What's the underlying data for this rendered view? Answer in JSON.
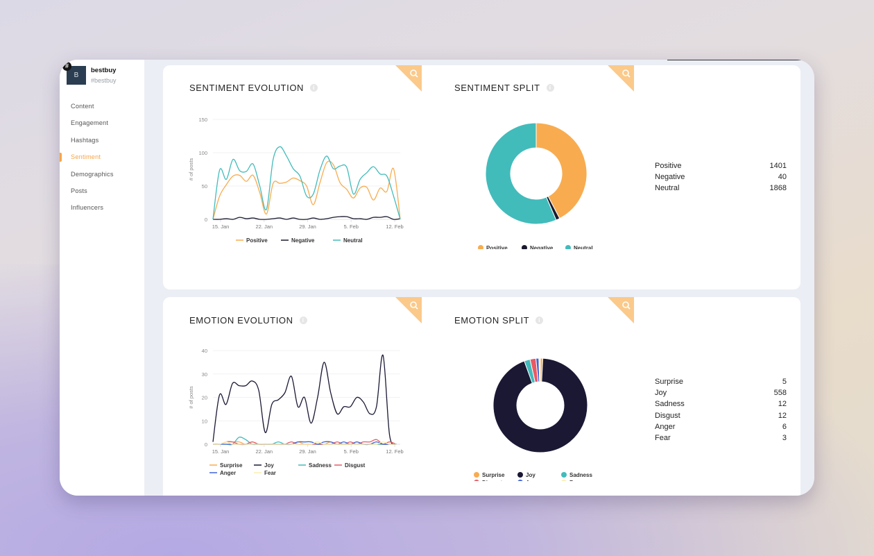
{
  "brand": {
    "avatar_letter": "B",
    "badge": "#",
    "name": "bestbuy",
    "handle": "#bestbuy"
  },
  "sidebar": {
    "items": [
      {
        "label": "Content",
        "active": false
      },
      {
        "label": "Engagement",
        "active": false
      },
      {
        "label": "Hashtags",
        "active": false
      },
      {
        "label": "Sentiment",
        "active": true
      },
      {
        "label": "Demographics",
        "active": false
      },
      {
        "label": "Posts",
        "active": false
      },
      {
        "label": "Influencers",
        "active": false
      }
    ]
  },
  "icons": {
    "zoom": "magnifier-icon",
    "info": "info-icon",
    "badge": "hashtag-icon"
  },
  "panels": {
    "sentiment_evolution": {
      "title": "SENTIMENT EVOLUTION",
      "info": "i"
    },
    "sentiment_split": {
      "title": "SENTIMENT SPLIT",
      "info": "i"
    },
    "emotion_evolution": {
      "title": "EMOTION EVOLUTION",
      "info": "i"
    },
    "emotion_split": {
      "title": "EMOTION SPLIT",
      "info": "i"
    }
  },
  "colors": {
    "accent": "#f6a54a",
    "positive": "#f8ac4f",
    "negative": "#1a1a2e",
    "neutral": "#42bbbb",
    "surprise": "#f8ac4f",
    "joy": "#1a1833",
    "sadness": "#42bbbb",
    "disgust": "#e85a64",
    "anger": "#3f63d8",
    "fear": "#fbeeb0"
  },
  "chart_data": [
    {
      "type": "line",
      "title": "SENTIMENT EVOLUTION",
      "xlabel": "",
      "ylabel": "# of posts",
      "ylim": [
        0,
        150
      ],
      "yticks": [
        "0",
        "50",
        "100",
        "150"
      ],
      "xticks": [
        "15. Jan",
        "22. Jan",
        "29. Jan",
        "5. Feb",
        "12. Feb"
      ],
      "x_days": [
        0,
        1,
        2,
        3,
        4,
        5,
        6,
        7,
        8,
        9,
        10,
        11,
        12,
        13,
        14,
        15,
        16,
        17,
        18,
        19,
        20,
        21,
        22,
        23,
        24,
        25,
        26,
        27,
        28,
        29,
        30,
        31,
        32,
        33,
        34,
        35,
        36,
        37,
        38,
        39,
        40
      ],
      "legend": "bottom",
      "grid": true,
      "series": [
        {
          "name": "Positive",
          "color": "#f8ac4f",
          "values": [
            0,
            35,
            52,
            65,
            66,
            57,
            66,
            40,
            8,
            54,
            54,
            56,
            62,
            58,
            50,
            22,
            55,
            85,
            82,
            55,
            45,
            32,
            47,
            48,
            29,
            47,
            42,
            76,
            0,
            0,
            0,
            0,
            0,
            0,
            0,
            0,
            0,
            0,
            0,
            0,
            0
          ]
        },
        {
          "name": "Negative",
          "color": "#1a1a2e",
          "values": [
            0,
            0,
            1,
            0,
            3,
            1,
            2,
            0,
            0,
            1,
            2,
            0,
            2,
            0,
            0,
            2,
            0,
            1,
            3,
            4,
            4,
            1,
            1,
            0,
            3,
            3,
            4,
            0,
            1,
            0,
            0,
            0,
            0,
            0,
            0,
            0,
            0,
            0,
            0,
            0,
            0
          ]
        },
        {
          "name": "Neutral",
          "color": "#42bbbb",
          "values": [
            0,
            74,
            60,
            90,
            73,
            72,
            83,
            50,
            15,
            90,
            109,
            95,
            76,
            65,
            35,
            38,
            74,
            95,
            76,
            80,
            78,
            38,
            60,
            70,
            79,
            68,
            65,
            35,
            0,
            0,
            0,
            0,
            0,
            0,
            0,
            0,
            0,
            0,
            0,
            0,
            0
          ]
        }
      ]
    },
    {
      "type": "pie",
      "title": "SENTIMENT SPLIT",
      "donut": true,
      "legend": "bottom",
      "labels": [
        "Positive",
        "Negative",
        "Neutral"
      ],
      "values": [
        1401,
        40,
        1868
      ],
      "colors": [
        "#f8ac4f",
        "#1a1a2e",
        "#42bbbb"
      ]
    },
    {
      "type": "line",
      "title": "EMOTION EVOLUTION",
      "xlabel": "",
      "ylabel": "# of posts",
      "ylim": [
        0,
        40
      ],
      "yticks": [
        "0",
        "10",
        "20",
        "30",
        "40"
      ],
      "xticks": [
        "15. Jan",
        "22. Jan",
        "29. Jan",
        "5. Feb",
        "12. Feb"
      ],
      "legend": "bottom",
      "grid": true,
      "series": [
        {
          "name": "Surprise",
          "color": "#f8ac4f",
          "values": [
            0,
            0,
            1,
            1,
            1,
            0,
            1,
            0,
            0,
            0,
            0,
            0,
            0,
            1,
            0,
            0,
            1,
            0,
            1,
            0,
            0,
            0,
            1,
            0,
            0,
            0,
            0,
            1,
            0
          ]
        },
        {
          "name": "Joy",
          "color": "#1a1833",
          "values": [
            1,
            21,
            17,
            26,
            25,
            25,
            27,
            23,
            5,
            17,
            19,
            22,
            29,
            16,
            20,
            9,
            20,
            35,
            22,
            13,
            16,
            16,
            20,
            18,
            13,
            16,
            38,
            4,
            0
          ]
        },
        {
          "name": "Sadness",
          "color": "#42bbbb",
          "values": [
            0,
            0,
            0,
            0,
            3,
            2,
            0,
            0,
            0,
            0,
            1,
            0,
            0,
            1,
            1,
            1,
            0,
            0,
            0,
            0,
            0,
            0,
            0,
            0,
            0,
            0,
            0,
            0,
            0
          ]
        },
        {
          "name": "Disgust",
          "color": "#e85a64",
          "values": [
            0,
            0,
            1,
            1,
            0,
            0,
            1,
            0,
            0,
            0,
            0,
            0,
            1,
            0,
            0,
            0,
            0,
            0,
            0,
            1,
            0,
            1,
            0,
            1,
            1,
            2,
            0,
            1,
            0
          ]
        },
        {
          "name": "Anger",
          "color": "#3f63d8",
          "values": [
            0,
            0,
            0,
            0,
            0,
            0,
            0,
            0,
            0,
            0,
            0,
            0,
            0,
            1,
            1,
            1,
            0,
            1,
            1,
            0,
            1,
            0,
            1,
            0,
            0,
            1,
            0,
            0,
            0
          ]
        },
        {
          "name": "Fear",
          "color": "#fbeeb0",
          "values": [
            0,
            0,
            1,
            0,
            0,
            0,
            0,
            0,
            0,
            0,
            0,
            0,
            0,
            0,
            0,
            0,
            1,
            0,
            0,
            0,
            0,
            0,
            0,
            0,
            0,
            0,
            1,
            0,
            0
          ]
        }
      ]
    },
    {
      "type": "pie",
      "title": "EMOTION SPLIT",
      "donut": true,
      "legend": "bottom",
      "labels": [
        "Surprise",
        "Joy",
        "Sadness",
        "Disgust",
        "Anger",
        "Fear"
      ],
      "values": [
        5,
        558,
        12,
        12,
        6,
        3
      ],
      "colors": [
        "#f8ac4f",
        "#1a1833",
        "#42bbbb",
        "#e85a64",
        "#3f63d8",
        "#fbeeb0"
      ]
    }
  ]
}
